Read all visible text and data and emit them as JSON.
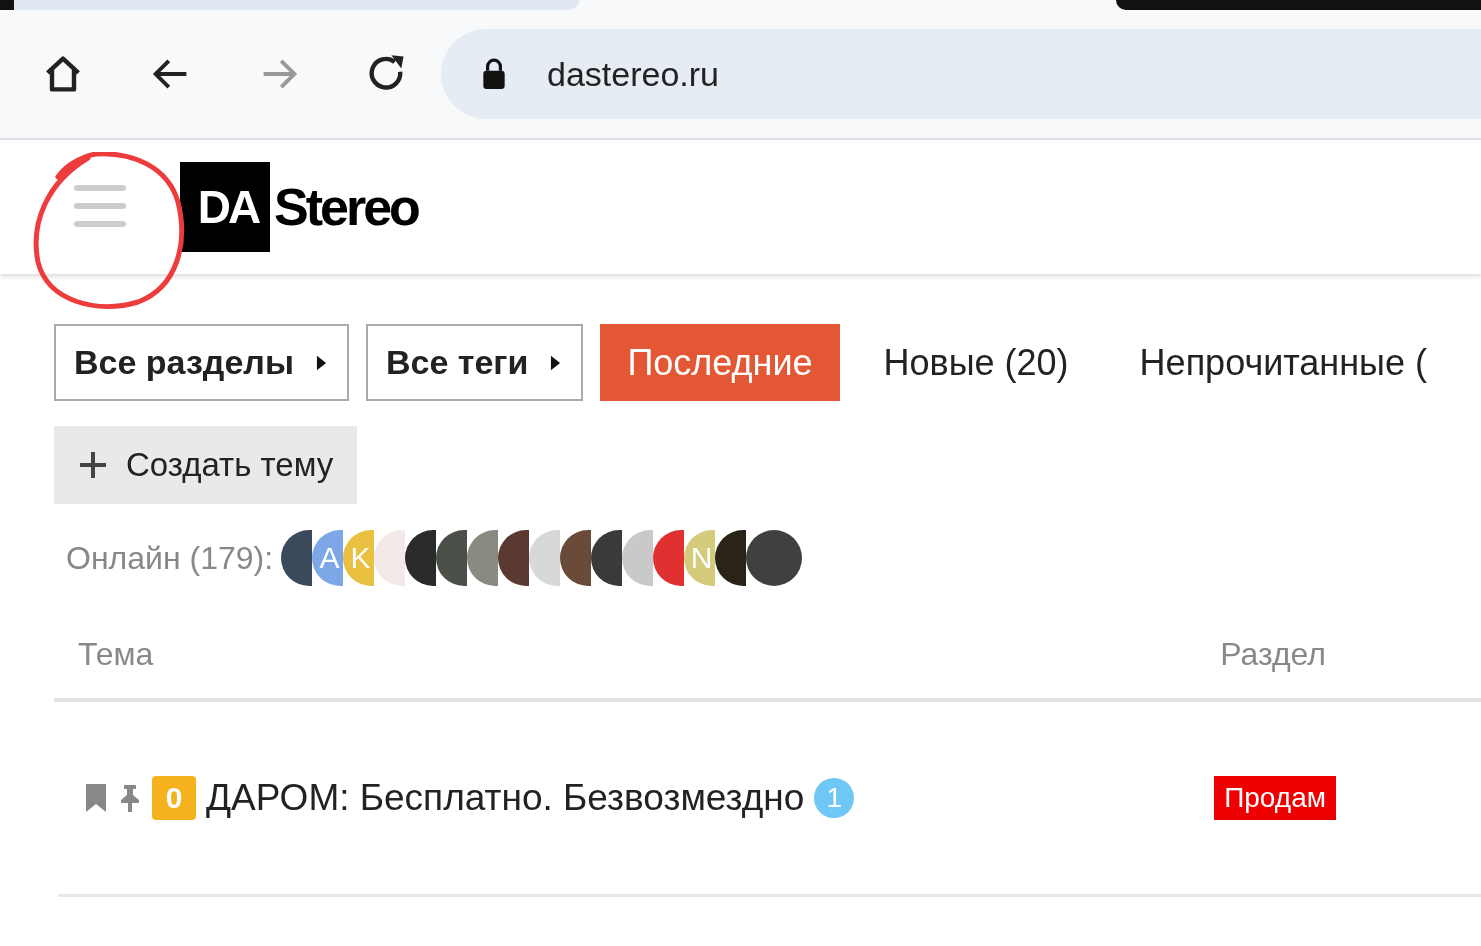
{
  "browser": {
    "url": "dastereo.ru"
  },
  "site": {
    "logo_mark": "DA",
    "logo_text": "Stereo"
  },
  "nav": [
    {
      "label": "Все разделы",
      "kind": "dropdown",
      "selected": false
    },
    {
      "label": "Все теги",
      "kind": "dropdown",
      "selected": false
    },
    {
      "label": "Последние",
      "kind": "tab",
      "selected": true
    },
    {
      "label": "Новые (20)",
      "kind": "tab",
      "selected": false
    },
    {
      "label": "Непрочитанные (",
      "kind": "tab",
      "selected": false
    }
  ],
  "create_button": {
    "label": "Создать тему"
  },
  "online": {
    "label": "Онлайн (179):",
    "avatars": [
      {
        "kind": "photo"
      },
      {
        "kind": "letter",
        "letter": "A",
        "color": "#7ea7e8"
      },
      {
        "kind": "letter",
        "letter": "K",
        "color": "#e9c03f"
      },
      {
        "kind": "photo"
      },
      {
        "kind": "photo"
      },
      {
        "kind": "photo"
      },
      {
        "kind": "photo"
      },
      {
        "kind": "photo"
      },
      {
        "kind": "photo"
      },
      {
        "kind": "photo"
      },
      {
        "kind": "photo"
      },
      {
        "kind": "photo"
      },
      {
        "kind": "photo"
      },
      {
        "kind": "letter",
        "letter": "N",
        "color": "#d4cb7c"
      },
      {
        "kind": "photo"
      },
      {
        "kind": "photo"
      }
    ]
  },
  "table": {
    "columns": [
      "Тема",
      "Раздел"
    ],
    "rows": [
      {
        "badge": "0",
        "title": "ДАРОМ: Бесплатно. Безвозмездно",
        "count": "1",
        "category": "Продам"
      }
    ]
  }
}
